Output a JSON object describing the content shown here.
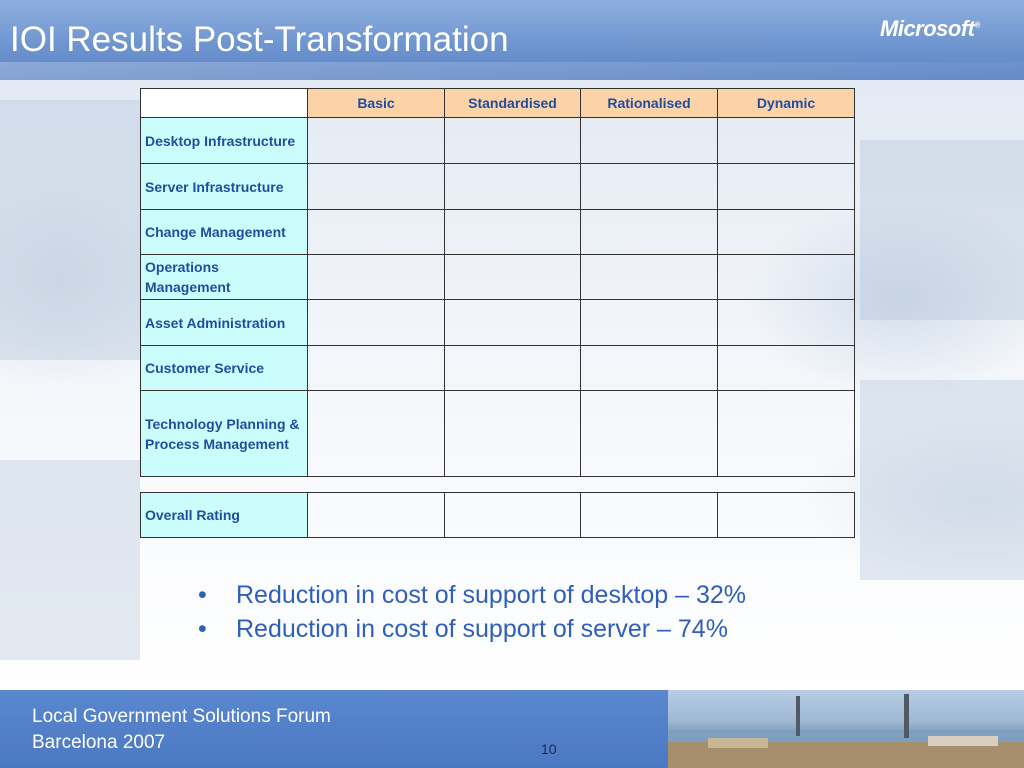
{
  "slide": {
    "title": "IOI Results Post-Transformation",
    "logo_text": "Microsoft",
    "page_number": "10"
  },
  "table": {
    "corner": "",
    "columns": [
      "Basic",
      "Standardised",
      "Rationalised",
      "Dynamic"
    ],
    "rows": [
      {
        "label": "Desktop Infrastructure",
        "cells": [
          "green",
          "green",
          "green",
          "white"
        ]
      },
      {
        "label": "Server Infrastructure",
        "cells": [
          "orange",
          "orange",
          "white",
          "white"
        ]
      },
      {
        "label": "Change Management",
        "cells": [
          "green",
          "green",
          "green",
          "white"
        ]
      },
      {
        "label": "Operations Management",
        "cells": [
          "orange",
          "orange",
          "white",
          "white"
        ]
      },
      {
        "label": "Asset Administration",
        "cells": [
          "green",
          "green",
          "green",
          "white"
        ]
      },
      {
        "label": "Customer Service",
        "cells": [
          "orange",
          "orange",
          "white",
          "white"
        ]
      },
      {
        "label": "Technology Planning & Process Management",
        "cells": [
          "orange",
          "orange",
          "white",
          "white"
        ]
      }
    ],
    "overall": {
      "label": "Overall Rating",
      "cells": [
        "orange",
        "orange",
        "white",
        "white"
      ]
    }
  },
  "colors": {
    "green": "#007f00",
    "orange": "#ff9900",
    "white": "#ffffff",
    "header_fill": "#fcd3a8",
    "label_fill": "#ccfdfd"
  },
  "bullets": [
    "Reduction in cost of support of desktop – 32%",
    "Reduction in cost of support of server – 74%"
  ],
  "bullet_glyph": "•",
  "footer": {
    "line1": "Local Government Solutions Forum",
    "line2": "Barcelona 2007"
  }
}
